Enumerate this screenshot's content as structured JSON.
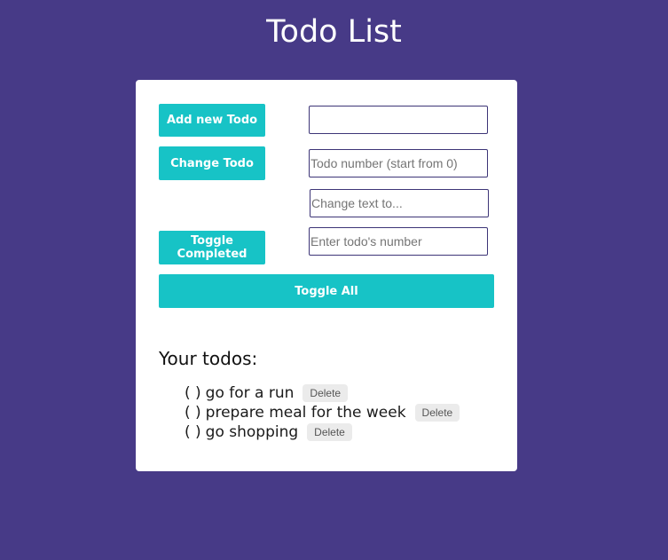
{
  "header": {
    "title": "Todo List"
  },
  "controls": {
    "add_label": "Add new Todo",
    "add_input_value": "",
    "change_label": "Change Todo",
    "change_number_placeholder": "Todo number (start from 0)",
    "change_text_placeholder": "Change text to...",
    "toggle_label": "Toggle Completed",
    "toggle_number_placeholder": "Enter todo's number",
    "toggle_all_label": "Toggle All"
  },
  "todos": {
    "heading": "Your todos:",
    "delete_label": "Delete",
    "items": [
      {
        "status": "( )",
        "text": "go for a run"
      },
      {
        "status": "( )",
        "text": "prepare meal for the week"
      },
      {
        "status": "( )",
        "text": "go shopping"
      }
    ]
  },
  "colors": {
    "background": "#473a87",
    "accent": "#17c3c6",
    "card": "#ffffff"
  }
}
